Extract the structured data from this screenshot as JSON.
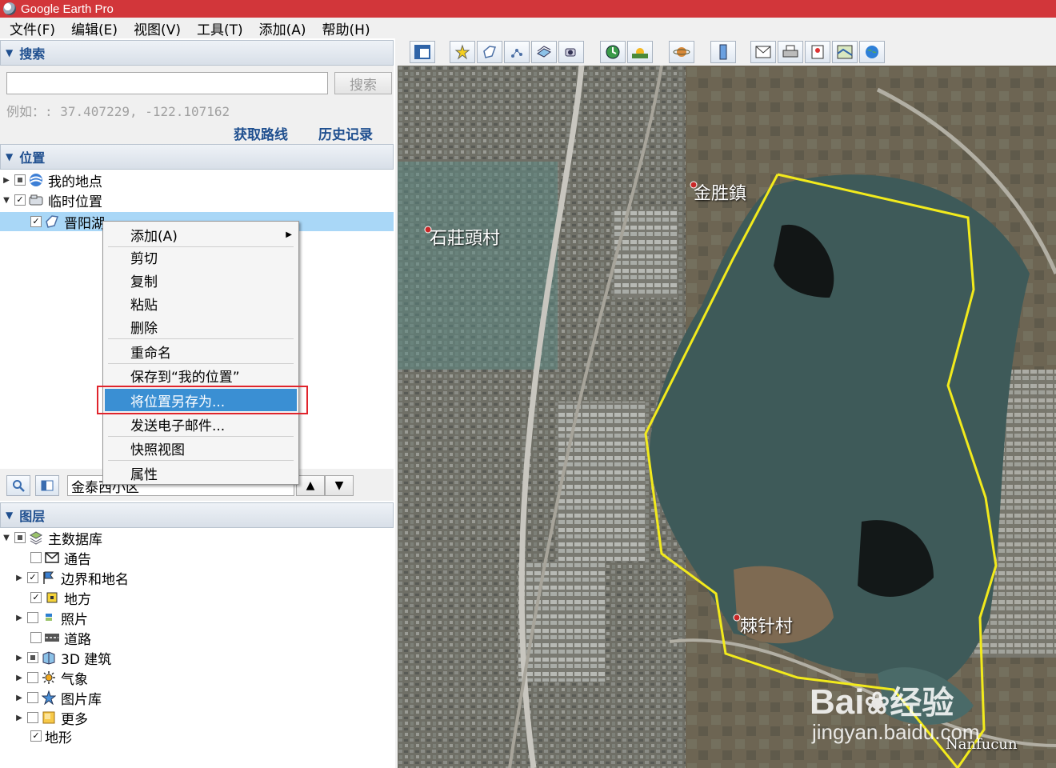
{
  "app": {
    "title": "Google Earth Pro"
  },
  "menubar": [
    "文件(F)",
    "编辑(E)",
    "视图(V)",
    "工具(T)",
    "添加(A)",
    "帮助(H)"
  ],
  "search": {
    "header": "搜索",
    "button": "搜索",
    "hint": "例如：: 37.407229, -122.107162",
    "get_directions": "获取路线",
    "history": "历史记录"
  },
  "places": {
    "header": "位置",
    "items": [
      {
        "label": "我的地点",
        "checkbox": "partial",
        "icon": "my-places-icon"
      },
      {
        "label": "临时位置",
        "checkbox": "checked",
        "icon": "temporary-places-icon"
      },
      {
        "label": "晋阳湖",
        "checkbox": "checked",
        "icon": "polygon-icon",
        "selected": true
      }
    ]
  },
  "context_menu": {
    "items": [
      {
        "label": "添加(A)",
        "submenu": true
      },
      {
        "label": "剪切"
      },
      {
        "label": "复制"
      },
      {
        "label": "粘贴"
      },
      {
        "label": "删除"
      },
      {
        "label": "重命名"
      },
      {
        "label": "保存到“我的位置”"
      },
      {
        "label": "将位置另存为...",
        "highlighted": true
      },
      {
        "label": "发送电子邮件..."
      },
      {
        "label": "快照视图"
      },
      {
        "label": "属性"
      }
    ]
  },
  "nav": {
    "field_value": "金泰西小区"
  },
  "layers": {
    "header": "图层",
    "items": [
      {
        "label": "主数据库",
        "checkbox": "partial",
        "icon": "database-icon"
      },
      {
        "label": "通告",
        "checkbox": "unchecked",
        "icon": "mail-icon"
      },
      {
        "label": "边界和地名",
        "checkbox": "checked",
        "icon": "flag-icon"
      },
      {
        "label": "地方",
        "checkbox": "checked",
        "icon": "places-icon"
      },
      {
        "label": "照片",
        "checkbox": "unchecked",
        "icon": "photo-icon"
      },
      {
        "label": "道路",
        "checkbox": "unchecked",
        "icon": "road-icon"
      },
      {
        "label": "3D 建筑",
        "checkbox": "partial",
        "icon": "building-icon"
      },
      {
        "label": "气象",
        "checkbox": "unchecked",
        "icon": "weather-icon"
      },
      {
        "label": "图片库",
        "checkbox": "unchecked",
        "icon": "gallery-icon"
      },
      {
        "label": "更多",
        "checkbox": "unchecked",
        "icon": "more-icon"
      },
      {
        "label": "地形",
        "checkbox": "checked",
        "icon": "terrain-icon"
      }
    ]
  },
  "map": {
    "labels": [
      "金胜鎮",
      "石莊頭村",
      "棘针村",
      "Nanfucun"
    ],
    "watermark": {
      "brand": "Bai",
      "brand2": "经验",
      "url": "jingyan.baidu.com"
    },
    "polygon_color": "#f2ea1c"
  }
}
